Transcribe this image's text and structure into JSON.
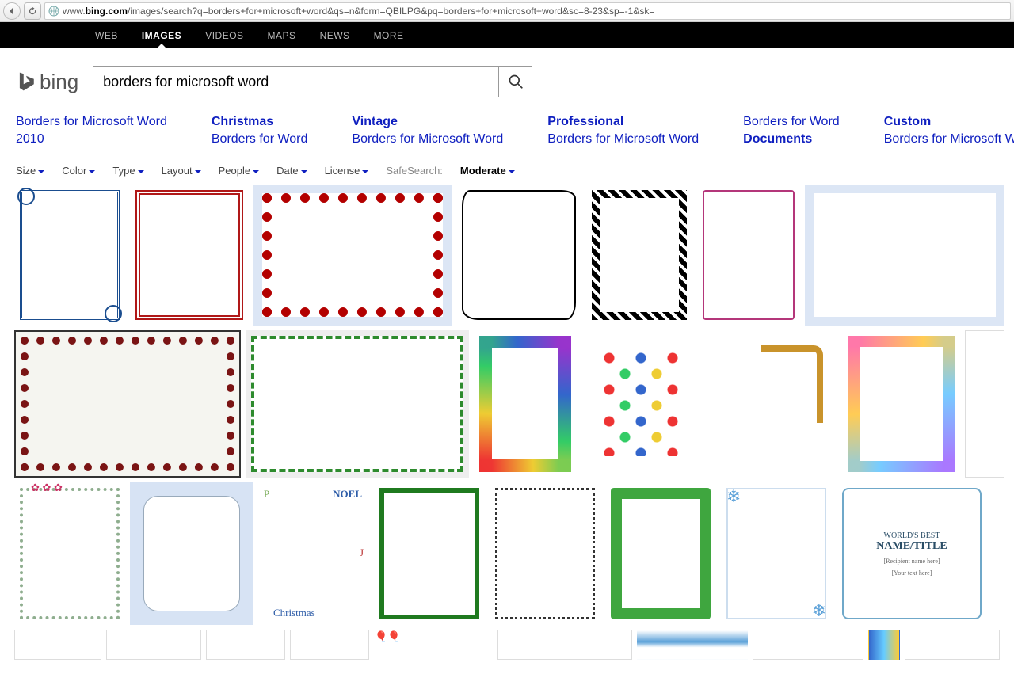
{
  "browser": {
    "url_prefix": "www.",
    "url_host": "bing.com",
    "url_rest": "/images/search?q=borders+for+microsoft+word&qs=n&form=QBILPG&pq=borders+for+microsoft+word&sc=8-23&sp=-1&sk="
  },
  "topnav": {
    "items": [
      "WEB",
      "IMAGES",
      "VIDEOS",
      "MAPS",
      "NEWS",
      "MORE"
    ],
    "active_index": 1
  },
  "logo_text": "bing",
  "search": {
    "value": "borders for microsoft word"
  },
  "related": [
    {
      "bold": "",
      "line1": "Borders for Microsoft Word",
      "line2": "2010"
    },
    {
      "bold": "Christmas",
      "line1": "",
      "line2": "Borders for Word"
    },
    {
      "bold": "Vintage",
      "line1": "",
      "line2": "Borders for Microsoft Word"
    },
    {
      "bold": "Professional",
      "line1": "",
      "line2": "Borders for Microsoft Word"
    },
    {
      "bold": "",
      "line1": "Borders for Word",
      "line2b": "Documents"
    },
    {
      "bold": "Custom",
      "line1": "",
      "line2": "Borders for Microsoft Word"
    }
  ],
  "filters": {
    "items": [
      "Size",
      "Color",
      "Type",
      "Layout",
      "People",
      "Date",
      "License"
    ],
    "safesearch_label": "SafeSearch:",
    "safesearch_value": "Moderate"
  },
  "cert": {
    "l1": "WORLD'S BEST",
    "l2": "NAME/TITLE",
    "l3a": "[Recipient name here]",
    "l3b": "[Your text here]"
  },
  "noel": {
    "t1": "NOEL",
    "t2": "Christmas",
    "t3": "P",
    "t4": "J"
  }
}
